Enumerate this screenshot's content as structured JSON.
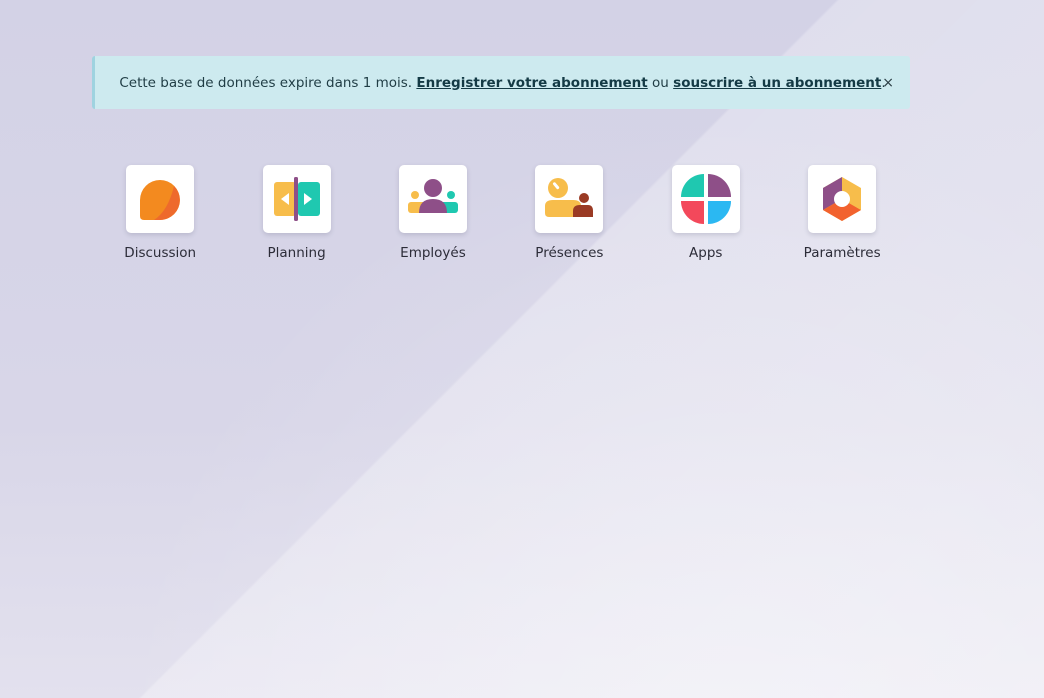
{
  "banner": {
    "text_before": "Cette base de données expire dans 1 mois. ",
    "link_register": "Enregistrer votre abonnement",
    "text_between": " ou ",
    "link_subscribe": "souscrire à un abonnement",
    "text_after": ".",
    "close_label": "×"
  },
  "apps": [
    {
      "label": "Discussion",
      "icon": "discussion-icon"
    },
    {
      "label": "Planning",
      "icon": "planning-icon"
    },
    {
      "label": "Employés",
      "icon": "employees-icon"
    },
    {
      "label": "Présences",
      "icon": "attendances-icon"
    },
    {
      "label": "Apps",
      "icon": "apps-icon"
    },
    {
      "label": "Paramètres",
      "icon": "settings-icon"
    }
  ],
  "colors": {
    "banner_bg": "#cdeaef",
    "orange": "#f38a1f",
    "yellow": "#f7bd4b",
    "teal": "#1fc8b0",
    "purple": "#8e4f88",
    "red": "#f3485b",
    "blue": "#2bb8f2"
  }
}
